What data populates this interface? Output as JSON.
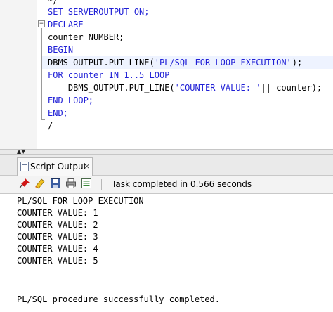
{
  "editor": {
    "lines": [
      {
        "kind": "text",
        "text": "*/"
      },
      {
        "kind": "kw",
        "text": "SET SERVEROUTPUT ON;"
      },
      {
        "kind": "kw",
        "text": "DECLARE"
      },
      {
        "kind": "text",
        "text": "counter NUMBER;"
      },
      {
        "kind": "kw",
        "text": "BEGIN"
      },
      {
        "kind": "mixed",
        "prefix": "DBMS_OUTPUT.PUT_LINE(",
        "literal": "'PL/SQL FOR LOOP EXECUTION'",
        "suffix": ");"
      },
      {
        "kind": "kw",
        "text": "FOR counter IN 1..5 LOOP"
      },
      {
        "kind": "mixed2",
        "indent": "    ",
        "prefix": "DBMS_OUTPUT.PUT_LINE(",
        "literal": "'COUNTER VALUE: '",
        "suffix": "|| counter);"
      },
      {
        "kind": "kw",
        "text": "END LOOP;"
      },
      {
        "kind": "kw",
        "text": "END;"
      },
      {
        "kind": "text",
        "text": "/"
      }
    ],
    "fold_symbol": "−"
  },
  "splitter": {
    "arrows": "▲▼"
  },
  "panel": {
    "tab_label": "Script Output",
    "tab_close": "×",
    "status": "Task completed in 0.566 seconds",
    "icons": [
      "pin-icon",
      "eraser-icon",
      "save-icon",
      "print-icon",
      "export-icon"
    ],
    "output_lines": [
      "PL/SQL FOR LOOP EXECUTION",
      "COUNTER VALUE: 1",
      "COUNTER VALUE: 2",
      "COUNTER VALUE: 3",
      "COUNTER VALUE: 4",
      "COUNTER VALUE: 5",
      "",
      "",
      "PL/SQL procedure successfully completed."
    ]
  },
  "colors": {
    "keyword": "#1f1fd6",
    "text": "#000000"
  }
}
